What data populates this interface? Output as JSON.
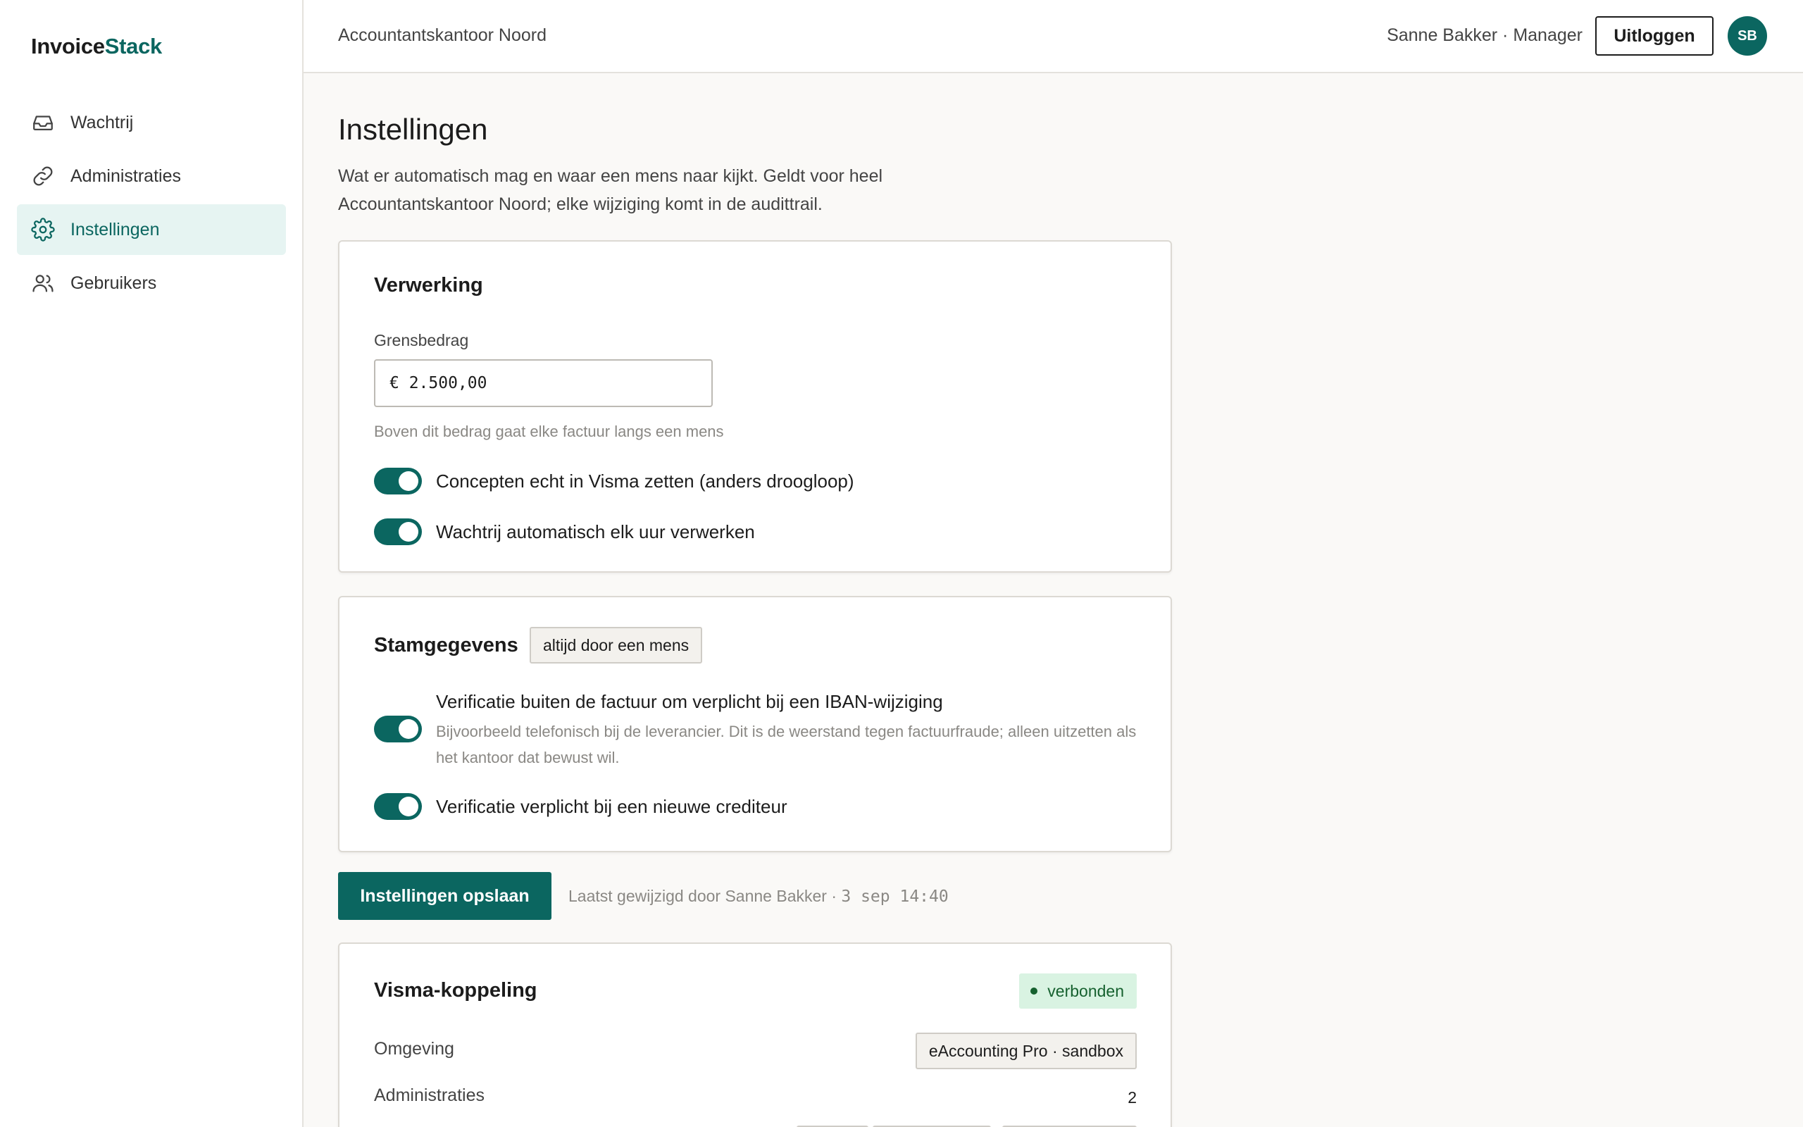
{
  "brand": {
    "part1": "Invoice",
    "part2": "Stack"
  },
  "sidebar": {
    "items": [
      {
        "label": "Wachtrij",
        "icon": "inbox-icon",
        "active": false
      },
      {
        "label": "Administraties",
        "icon": "link-icon",
        "active": false
      },
      {
        "label": "Instellingen",
        "icon": "gear-icon",
        "active": true
      },
      {
        "label": "Gebruikers",
        "icon": "users-icon",
        "active": false
      }
    ]
  },
  "header": {
    "org": "Accountantskantoor Noord",
    "user": "Sanne Bakker · Manager",
    "logout_label": "Uitloggen",
    "avatar_initials": "SB"
  },
  "page": {
    "title": "Instellingen",
    "description": "Wat er automatisch mag en waar een mens naar kijkt. Geldt voor heel Accountantskantoor Noord; elke wijziging komt in de audittrail."
  },
  "processing": {
    "title": "Verwerking",
    "threshold_label": "Grensbedrag",
    "threshold_value": "€ 2.500,00",
    "threshold_hint": "Boven dit bedrag gaat elke factuur langs een mens",
    "toggles": [
      {
        "label": "Concepten echt in Visma zetten (anders droogloop)",
        "on": true
      },
      {
        "label": "Wachtrij automatisch elk uur verwerken",
        "on": true
      }
    ]
  },
  "master_data": {
    "title": "Stamgegevens",
    "chip": "altijd door een mens",
    "toggles": [
      {
        "label": "Verificatie buiten de factuur om verplicht bij een IBAN-wijziging",
        "description": "Bijvoorbeeld telefonisch bij de leverancier. Dit is de weerstand tegen factuurfraude; alleen uitzetten als het kantoor dat bewust wil.",
        "on": true
      },
      {
        "label": "Verificatie verplicht bij een nieuwe crediteur",
        "on": true
      }
    ]
  },
  "save": {
    "button_label": "Instellingen opslaan",
    "meta_prefix": "Laatst gewijzigd door Sanne Bakker · ",
    "meta_timestamp": "3 sep 14:40"
  },
  "visma": {
    "title": "Visma-koppeling",
    "status": "verbonden",
    "environment_label": "Omgeving",
    "environment_value": "eAccounting Pro · sandbox",
    "administrations_label": "Administraties",
    "administrations_value": "2"
  },
  "colors": {
    "accent": "#0b6660",
    "active_nav_bg": "#e6f4f2",
    "status_bg": "#d9f3e2",
    "status_text": "#16612f"
  }
}
